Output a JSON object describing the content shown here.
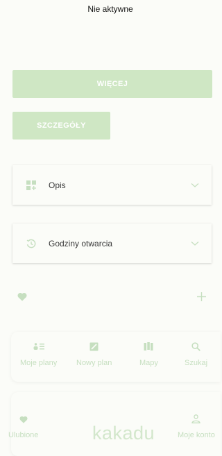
{
  "status": {
    "title": "Nie aktywne"
  },
  "actions": {
    "more_label": "WIĘCEJ",
    "details_label": "SZCZEGÓŁY"
  },
  "sections": {
    "description": {
      "label": "Opis",
      "icon": "widgets-icon"
    },
    "hours": {
      "label": "Godziny otwarcia",
      "icon": "clock-history-icon"
    }
  },
  "nav_top": [
    {
      "label": "Moje plany",
      "icon": "list-icon"
    },
    {
      "label": "Nowy plan",
      "icon": "edit-icon"
    },
    {
      "label": "Mapy",
      "icon": "map-icon"
    },
    {
      "label": "Szukaj",
      "icon": "search-icon"
    }
  ],
  "nav_bottom": {
    "favorites": {
      "label": "Ulubione",
      "icon": "heart-icon"
    },
    "brand": "kakadu",
    "account": {
      "label": "Moje konto",
      "icon": "person-icon"
    }
  },
  "colors": {
    "accent": "#cfe7c4",
    "icon_green": "#c6dfc0",
    "background": "#fbfcf8"
  }
}
